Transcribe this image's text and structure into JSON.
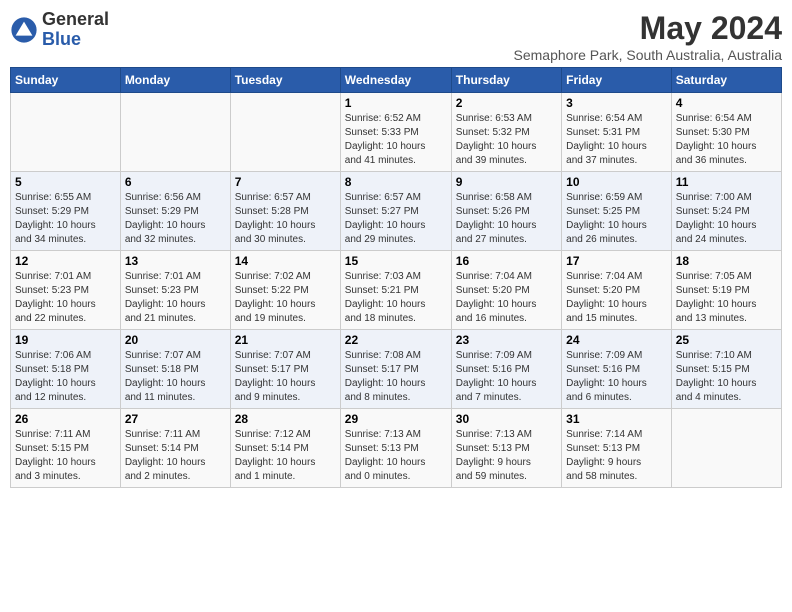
{
  "logo": {
    "general": "General",
    "blue": "Blue"
  },
  "title": "May 2024",
  "subtitle": "Semaphore Park, South Australia, Australia",
  "days_header": [
    "Sunday",
    "Monday",
    "Tuesday",
    "Wednesday",
    "Thursday",
    "Friday",
    "Saturday"
  ],
  "weeks": [
    [
      {
        "day": "",
        "info": ""
      },
      {
        "day": "",
        "info": ""
      },
      {
        "day": "",
        "info": ""
      },
      {
        "day": "1",
        "info": "Sunrise: 6:52 AM\nSunset: 5:33 PM\nDaylight: 10 hours\nand 41 minutes."
      },
      {
        "day": "2",
        "info": "Sunrise: 6:53 AM\nSunset: 5:32 PM\nDaylight: 10 hours\nand 39 minutes."
      },
      {
        "day": "3",
        "info": "Sunrise: 6:54 AM\nSunset: 5:31 PM\nDaylight: 10 hours\nand 37 minutes."
      },
      {
        "day": "4",
        "info": "Sunrise: 6:54 AM\nSunset: 5:30 PM\nDaylight: 10 hours\nand 36 minutes."
      }
    ],
    [
      {
        "day": "5",
        "info": "Sunrise: 6:55 AM\nSunset: 5:29 PM\nDaylight: 10 hours\nand 34 minutes."
      },
      {
        "day": "6",
        "info": "Sunrise: 6:56 AM\nSunset: 5:29 PM\nDaylight: 10 hours\nand 32 minutes."
      },
      {
        "day": "7",
        "info": "Sunrise: 6:57 AM\nSunset: 5:28 PM\nDaylight: 10 hours\nand 30 minutes."
      },
      {
        "day": "8",
        "info": "Sunrise: 6:57 AM\nSunset: 5:27 PM\nDaylight: 10 hours\nand 29 minutes."
      },
      {
        "day": "9",
        "info": "Sunrise: 6:58 AM\nSunset: 5:26 PM\nDaylight: 10 hours\nand 27 minutes."
      },
      {
        "day": "10",
        "info": "Sunrise: 6:59 AM\nSunset: 5:25 PM\nDaylight: 10 hours\nand 26 minutes."
      },
      {
        "day": "11",
        "info": "Sunrise: 7:00 AM\nSunset: 5:24 PM\nDaylight: 10 hours\nand 24 minutes."
      }
    ],
    [
      {
        "day": "12",
        "info": "Sunrise: 7:01 AM\nSunset: 5:23 PM\nDaylight: 10 hours\nand 22 minutes."
      },
      {
        "day": "13",
        "info": "Sunrise: 7:01 AM\nSunset: 5:23 PM\nDaylight: 10 hours\nand 21 minutes."
      },
      {
        "day": "14",
        "info": "Sunrise: 7:02 AM\nSunset: 5:22 PM\nDaylight: 10 hours\nand 19 minutes."
      },
      {
        "day": "15",
        "info": "Sunrise: 7:03 AM\nSunset: 5:21 PM\nDaylight: 10 hours\nand 18 minutes."
      },
      {
        "day": "16",
        "info": "Sunrise: 7:04 AM\nSunset: 5:20 PM\nDaylight: 10 hours\nand 16 minutes."
      },
      {
        "day": "17",
        "info": "Sunrise: 7:04 AM\nSunset: 5:20 PM\nDaylight: 10 hours\nand 15 minutes."
      },
      {
        "day": "18",
        "info": "Sunrise: 7:05 AM\nSunset: 5:19 PM\nDaylight: 10 hours\nand 13 minutes."
      }
    ],
    [
      {
        "day": "19",
        "info": "Sunrise: 7:06 AM\nSunset: 5:18 PM\nDaylight: 10 hours\nand 12 minutes."
      },
      {
        "day": "20",
        "info": "Sunrise: 7:07 AM\nSunset: 5:18 PM\nDaylight: 10 hours\nand 11 minutes."
      },
      {
        "day": "21",
        "info": "Sunrise: 7:07 AM\nSunset: 5:17 PM\nDaylight: 10 hours\nand 9 minutes."
      },
      {
        "day": "22",
        "info": "Sunrise: 7:08 AM\nSunset: 5:17 PM\nDaylight: 10 hours\nand 8 minutes."
      },
      {
        "day": "23",
        "info": "Sunrise: 7:09 AM\nSunset: 5:16 PM\nDaylight: 10 hours\nand 7 minutes."
      },
      {
        "day": "24",
        "info": "Sunrise: 7:09 AM\nSunset: 5:16 PM\nDaylight: 10 hours\nand 6 minutes."
      },
      {
        "day": "25",
        "info": "Sunrise: 7:10 AM\nSunset: 5:15 PM\nDaylight: 10 hours\nand 4 minutes."
      }
    ],
    [
      {
        "day": "26",
        "info": "Sunrise: 7:11 AM\nSunset: 5:15 PM\nDaylight: 10 hours\nand 3 minutes."
      },
      {
        "day": "27",
        "info": "Sunrise: 7:11 AM\nSunset: 5:14 PM\nDaylight: 10 hours\nand 2 minutes."
      },
      {
        "day": "28",
        "info": "Sunrise: 7:12 AM\nSunset: 5:14 PM\nDaylight: 10 hours\nand 1 minute."
      },
      {
        "day": "29",
        "info": "Sunrise: 7:13 AM\nSunset: 5:13 PM\nDaylight: 10 hours\nand 0 minutes."
      },
      {
        "day": "30",
        "info": "Sunrise: 7:13 AM\nSunset: 5:13 PM\nDaylight: 9 hours\nand 59 minutes."
      },
      {
        "day": "31",
        "info": "Sunrise: 7:14 AM\nSunset: 5:13 PM\nDaylight: 9 hours\nand 58 minutes."
      },
      {
        "day": "",
        "info": ""
      }
    ]
  ]
}
